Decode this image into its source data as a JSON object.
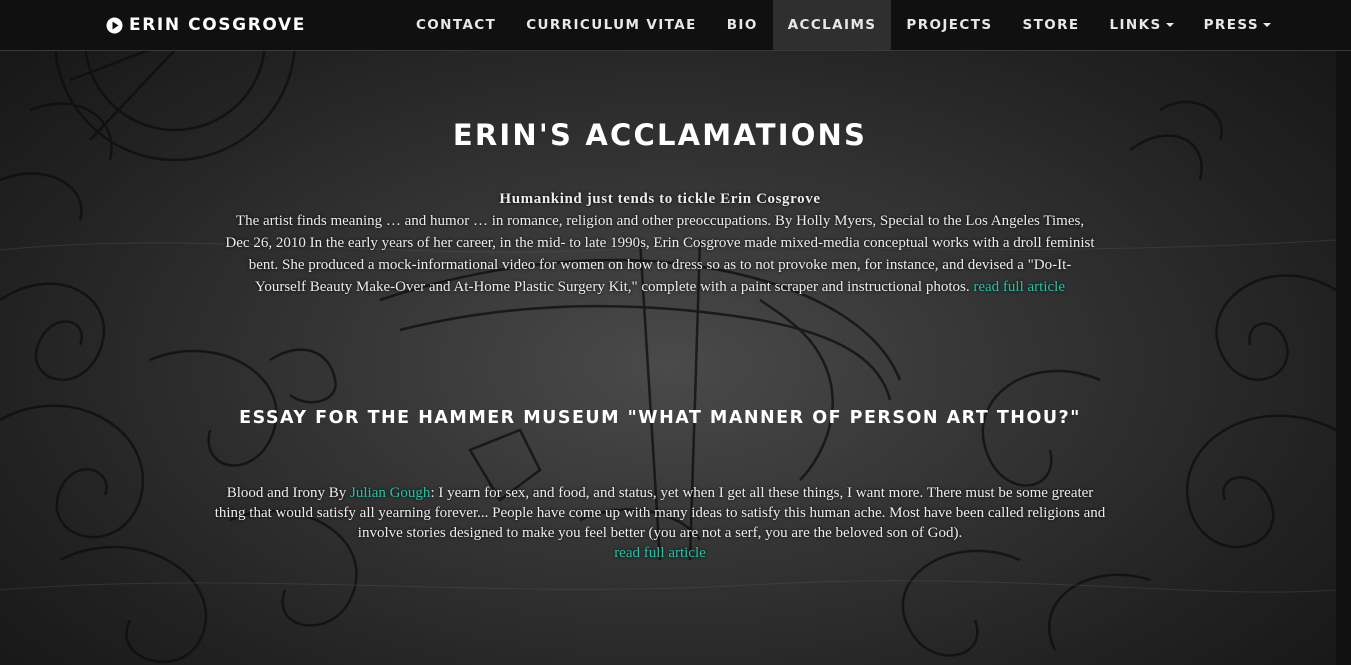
{
  "brand": {
    "name": "ERIN COSGROVE",
    "icon": "play-circle-icon"
  },
  "nav": {
    "items": [
      {
        "label": "CONTACT"
      },
      {
        "label": "CURRICULUM VITAE"
      },
      {
        "label": "BIO"
      },
      {
        "label": "ACCLAIMS"
      },
      {
        "label": "PROJECTS"
      },
      {
        "label": "STORE"
      },
      {
        "label": "LINKS"
      },
      {
        "label": "PRESS"
      }
    ],
    "active": "ACCLAIMS"
  },
  "colors": {
    "link": "#22c4a6",
    "nav_bg": "#101010",
    "nav_active_bg": "#2f2f2f",
    "text": "#ececec"
  },
  "main": {
    "title": "ERIN'S ACCLAMATIONS",
    "article1": {
      "headline": "Humankind just tends to tickle Erin Cosgrove",
      "body": "The artist finds meaning … and humor … in romance, religion and other preoccupations. By Holly Myers, Special to the Los Angeles Times, Dec 26, 2010 In the early years of her career, in the mid- to late 1990s, Erin Cosgrove made mixed-media conceptual works with a droll feminist bent. She produced a mock-informational video for women on how to dress so as to not provoke men, for instance, and devised a \"Do-It-Yourself Beauty Make-Over and At-Home Plastic Surgery Kit,\" complete with a paint scraper and instructional photos.",
      "link": "read full article"
    },
    "section2_title": "ESSAY FOR THE HAMMER MUSEUM \"WHAT MANNER OF PERSON ART THOU?\"",
    "article2": {
      "prefix": "Blood and Irony By",
      "author_link": "Julian Gough",
      "body": ": I yearn for sex, and food, and status, yet when I get all these things, I want more. There must be some greater thing that would satisfy all yearning forever... People have come up with many ideas to satisfy this human ache. Most have been called religions and involve stories designed to make you feel better (you are not a serf, you are the beloved son of God).",
      "link": "read full article"
    }
  }
}
